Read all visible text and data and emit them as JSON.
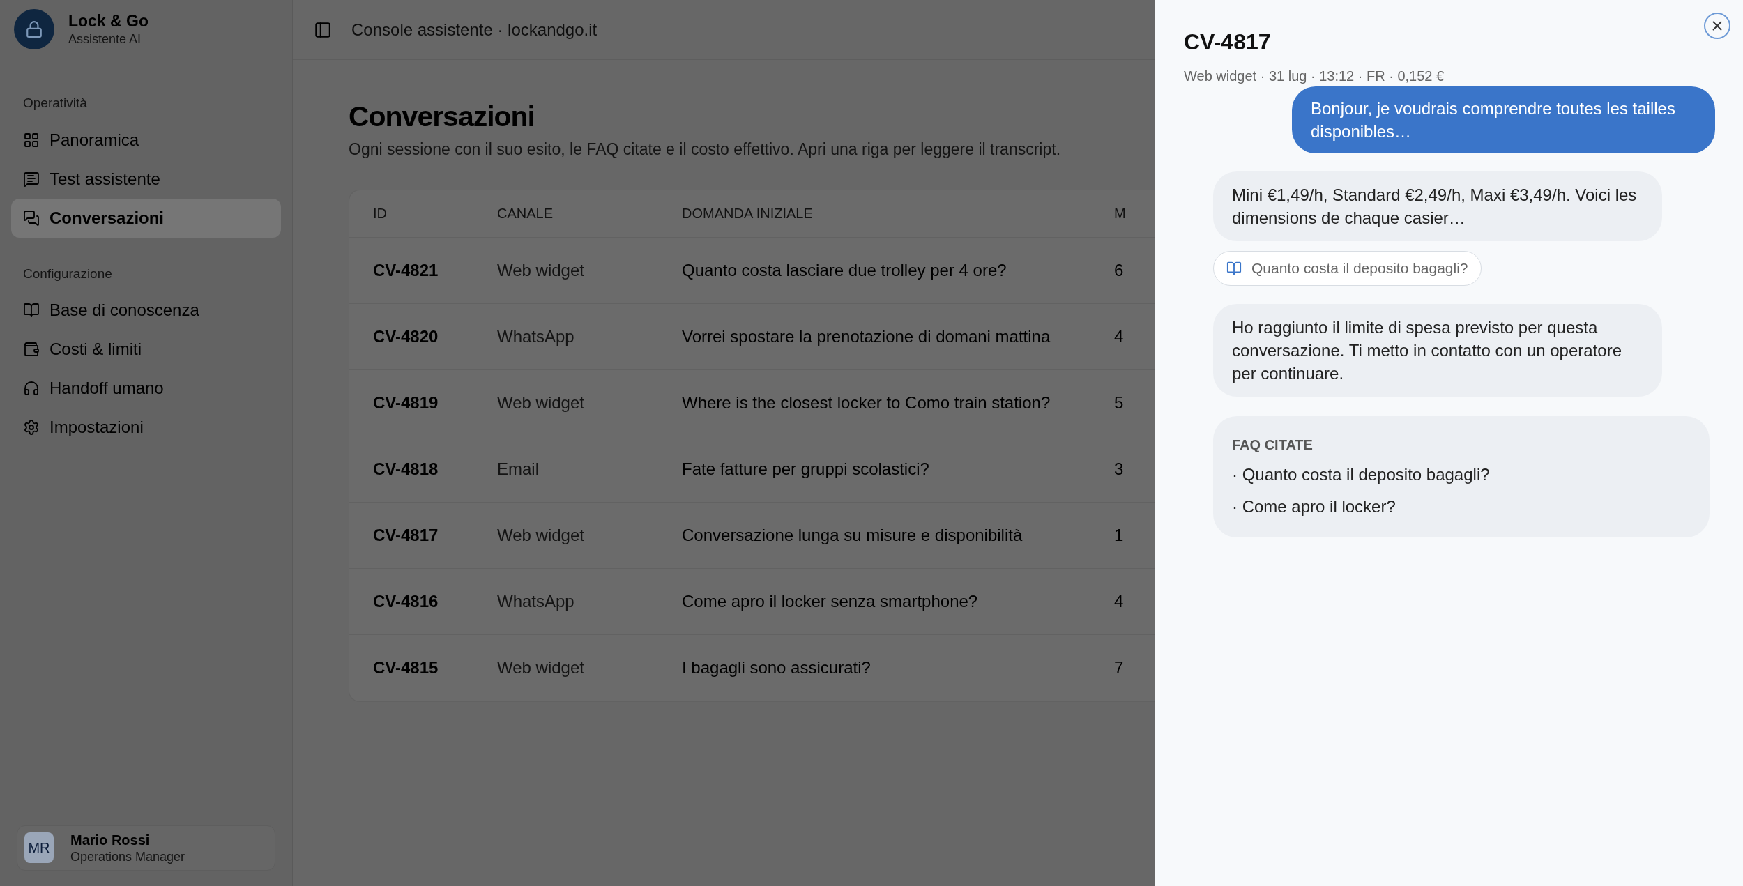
{
  "brand": {
    "name": "Lock & Go",
    "subtitle": "Assistente AI"
  },
  "sidebar": {
    "sections": [
      {
        "label": "Operatività",
        "items": [
          {
            "label": "Panoramica",
            "selected": false
          },
          {
            "label": "Test assistente",
            "selected": false
          },
          {
            "label": "Conversazioni",
            "selected": true
          }
        ]
      },
      {
        "label": "Configurazione",
        "items": [
          {
            "label": "Base di conoscenza",
            "selected": false
          },
          {
            "label": "Costi & limiti",
            "selected": false
          },
          {
            "label": "Handoff umano",
            "selected": false
          },
          {
            "label": "Impostazioni",
            "selected": false
          }
        ]
      }
    ]
  },
  "user": {
    "initials": "MR",
    "name": "Mario Rossi",
    "role": "Operations Manager"
  },
  "topbar": {
    "title": "Console assistente · lockandgo.it"
  },
  "page": {
    "title": "Conversazioni",
    "subtitle": "Ogni sessione con il suo esito, le FAQ citate e il costo effettivo. Apri una riga per leggere il transcript."
  },
  "table": {
    "columns": [
      "ID",
      "CANALE",
      "DOMANDA INIZIALE",
      "M"
    ],
    "rows": [
      {
        "id": "CV-4821",
        "channel": "Web widget",
        "question": "Quanto costa lasciare due trolley per 4 ore?",
        "column_4": "6"
      },
      {
        "id": "CV-4820",
        "channel": "WhatsApp",
        "question": "Vorrei spostare la prenotazione di domani mattina",
        "column_4": "4"
      },
      {
        "id": "CV-4819",
        "channel": "Web widget",
        "question": "Where is the closest locker to Como train station?",
        "column_4": "5"
      },
      {
        "id": "CV-4818",
        "channel": "Email",
        "question": "Fate fatture per gruppi scolastici?",
        "column_4": "3"
      },
      {
        "id": "CV-4817",
        "channel": "Web widget",
        "question": "Conversazione lunga su misure e disponibilità",
        "column_4": "1"
      },
      {
        "id": "CV-4816",
        "channel": "WhatsApp",
        "question": "Come apro il locker senza smartphone?",
        "column_4": "4"
      },
      {
        "id": "CV-4815",
        "channel": "Web widget",
        "question": "I bagagli sono assicurati?",
        "column_4": "7"
      }
    ]
  },
  "drawer": {
    "title": "CV-4817",
    "meta": "Web widget · 31 lug · 13:12 · FR · 0,152 €",
    "messages": [
      {
        "kind": "user",
        "text": "Bonjour, je voudrais comprendre toutes les tailles disponibles…"
      },
      {
        "kind": "assistant",
        "text": "Mini €1,49/h, Standard €2,49/h, Maxi €3,49/h. Voici les dimensions de chaque casier…"
      },
      {
        "kind": "citation",
        "text": "Quanto costa il deposito bagagli?"
      },
      {
        "kind": "assistant",
        "text": "Ho raggiunto il limite di spesa previsto per questa conversazione. Ti metto in contatto con un operatore per continuare."
      }
    ],
    "faq": {
      "title": "FAQ CITATE",
      "items": [
        "· Quanto costa il deposito bagagli?",
        "· Come apro il locker?"
      ]
    }
  }
}
